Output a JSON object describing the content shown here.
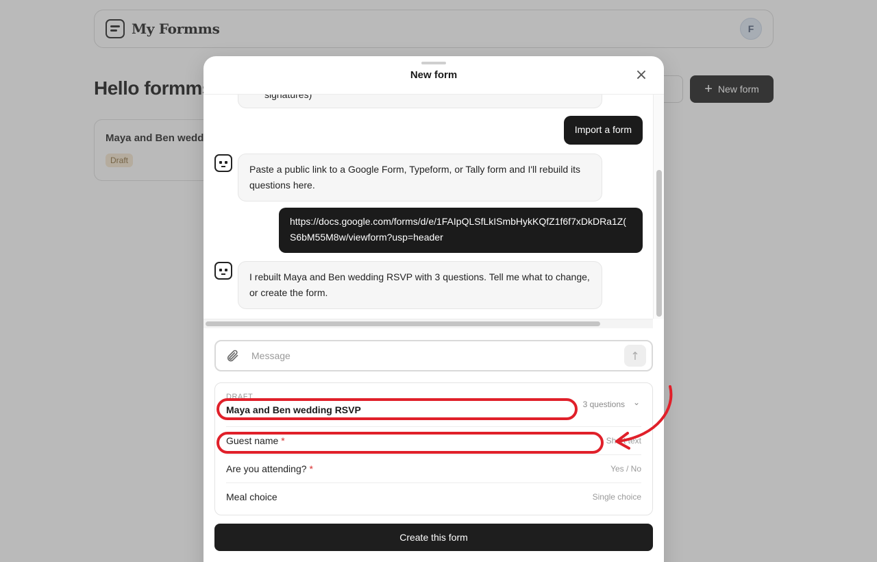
{
  "app": {
    "name": "My Formms",
    "avatar_initial": "F",
    "greeting": "Hello formms",
    "new_form_label": "New form"
  },
  "forms_list": [
    {
      "title": "Maya and Ben wedd",
      "status": "Draft"
    }
  ],
  "modal": {
    "title": "New form",
    "close_icon": "close-icon",
    "chat": {
      "partial_top_text": "signatures)",
      "messages": [
        {
          "role": "user",
          "text": "Import a form"
        },
        {
          "role": "assistant",
          "text": "Paste a public link to a Google Form, Typeform, or Tally form and I'll rebuild its questions here."
        },
        {
          "role": "user",
          "text_line1": "https://docs.google.com/forms/d/e/1FAIpQLSfLkISmbHykKQfZ1f6f7xDkDRa1Z(",
          "text_line2": "S6bM55M8w/viewform?usp=header"
        },
        {
          "role": "assistant",
          "text": "I rebuilt Maya and Ben wedding RSVP with 3 questions. Tell me what to change, or create the form."
        }
      ]
    },
    "message_box": {
      "placeholder": "Message"
    },
    "draft": {
      "label": "DRAFT",
      "title": "Maya and Ben wedding RSVP",
      "question_count": "3 questions",
      "questions": [
        {
          "label": "Guest name",
          "required": "*",
          "type": "Short text"
        },
        {
          "label": "Are you attending?",
          "required": "*",
          "type": "Yes / No"
        },
        {
          "label": "Meal choice",
          "required": "",
          "type": "Single choice"
        }
      ]
    },
    "create_label": "Create this form"
  },
  "colors": {
    "accent_dark": "#1b1b1b",
    "annotation_red": "#e0202a",
    "required_red": "#d93030",
    "draft_badge_bg": "#f6e7cf"
  }
}
